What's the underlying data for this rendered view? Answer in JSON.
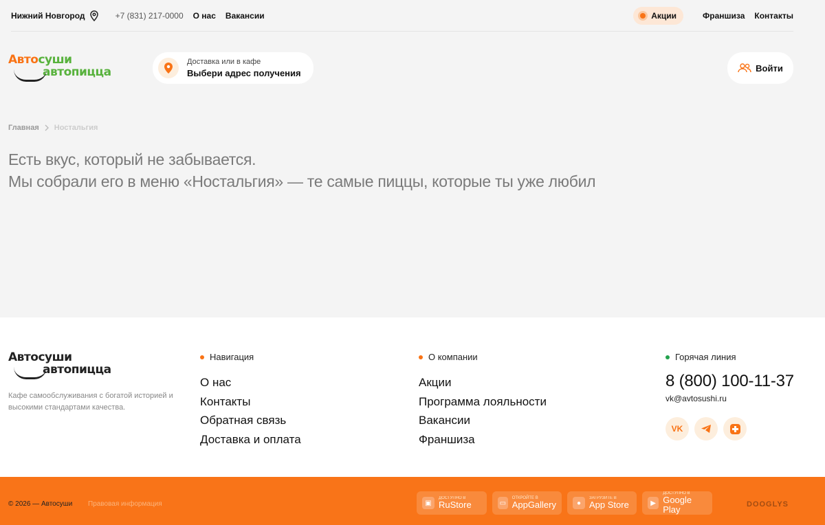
{
  "topbar": {
    "city": "Нижний Новгород",
    "phone": "+7 (831) 217-0000",
    "links": [
      "О нас",
      "Вакансии"
    ],
    "promo": "Акции",
    "right_links": [
      "Франшиза",
      "Контакты"
    ]
  },
  "logo": {
    "line1_a": "Авто",
    "line1_b": "суши",
    "line2_a": "авто",
    "line2_b": "пицца"
  },
  "address": {
    "sub": "Доставка или в кафе",
    "main": "Выбери адрес получения"
  },
  "login": {
    "label": "Войти"
  },
  "breadcrumb": {
    "home": "Главная",
    "current": "Ностальгия"
  },
  "hero": {
    "line1": "Есть вкус, который не забывается.",
    "line2": "Мы собрали его в меню «Ностальгия» — те самые пиццы, которые ты уже любил"
  },
  "footer": {
    "description": "Кафе самообслуживания с богатой историей и высокими стандартами качества.",
    "nav": {
      "title": "Навигация",
      "items": [
        "О нас",
        "Контакты",
        "Обратная связь",
        "Доставка и оплата"
      ]
    },
    "company": {
      "title": "О компании",
      "items": [
        "Акции",
        "Программа лояльности",
        "Вакансии",
        "Франшиза"
      ]
    },
    "hotline": {
      "title": "Горячая линия",
      "phone": "8 (800) 100-11-37",
      "email": "vk@avtosushi.ru"
    },
    "socials": [
      "vk-icon",
      "telegram-icon",
      "ok-icon"
    ]
  },
  "bottom": {
    "copyright": "© 2026 — Автосуши",
    "legal": "Правовая информация",
    "stores": [
      {
        "small": "Доступно в",
        "name": "RuStore"
      },
      {
        "small": "Откройте в",
        "name": "AppGallery"
      },
      {
        "small": "Загрузите в",
        "name": "App Store"
      },
      {
        "small": "Доступно в",
        "name": "Google Play"
      }
    ],
    "developer": "DOOGLYS"
  },
  "colors": {
    "accent": "#f97315",
    "green": "#58b23d",
    "background": "#f4f4f4"
  }
}
